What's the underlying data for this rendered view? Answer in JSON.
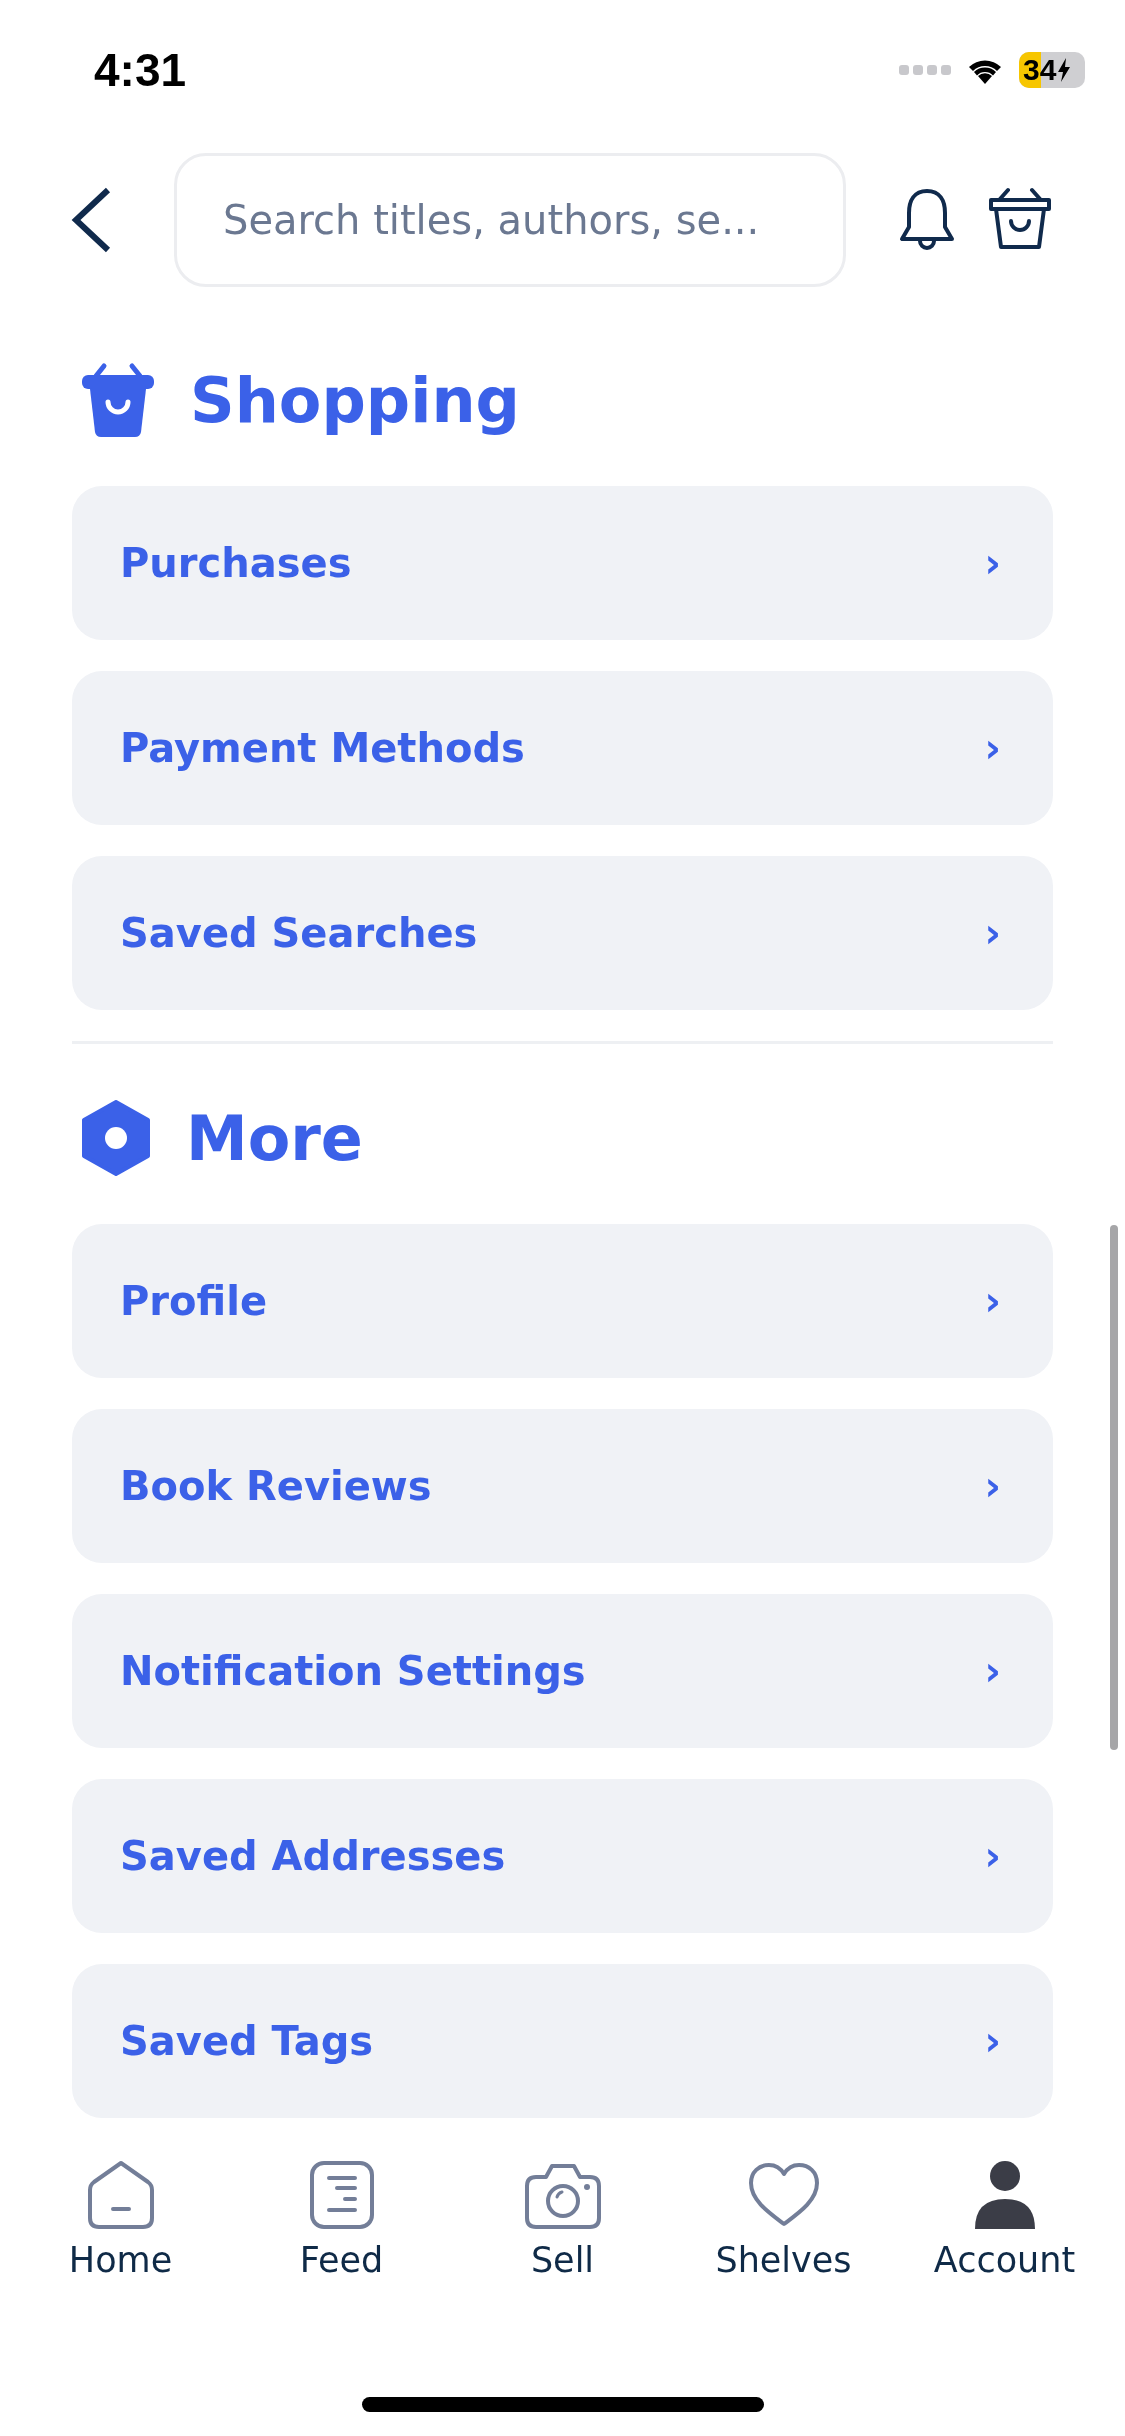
{
  "status_bar": {
    "time": "4:31",
    "battery": "34"
  },
  "header": {
    "search": {
      "placeholder": "Search titles, authors, se..."
    }
  },
  "sections": [
    {
      "title": "Shopping",
      "kind": "basket",
      "items": [
        {
          "label": "Purchases",
          "chevron": "›"
        },
        {
          "label": "Payment Methods",
          "chevron": "›"
        },
        {
          "label": "Saved Searches",
          "chevron": "›"
        }
      ]
    },
    {
      "title": "More",
      "kind": "hexagon",
      "items": [
        {
          "label": "Profile",
          "chevron": "›"
        },
        {
          "label": "Book Reviews",
          "chevron": "›"
        },
        {
          "label": "Notification Settings",
          "chevron": "›"
        },
        {
          "label": "Saved Addresses",
          "chevron": "›"
        },
        {
          "label": "Saved Tags",
          "chevron": "›"
        }
      ]
    }
  ],
  "tab_bar": [
    {
      "label": "Home",
      "kind": "home",
      "selected": false
    },
    {
      "label": "Feed",
      "kind": "feed",
      "selected": false
    },
    {
      "label": "Sell",
      "kind": "camera",
      "selected": false
    },
    {
      "label": "Shelves",
      "kind": "heart",
      "selected": false
    },
    {
      "label": "Account",
      "kind": "person",
      "selected": true
    }
  ]
}
